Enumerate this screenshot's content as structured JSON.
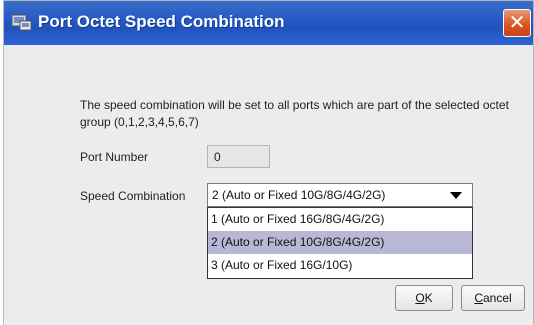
{
  "window": {
    "title": "Port Octet Speed Combination",
    "close_glyph": "✕"
  },
  "description": "The speed combination will be set to all ports which are part of the selected octet group (0,1,2,3,4,5,6,7)",
  "port_number": {
    "label": "Port Number",
    "value": "0"
  },
  "speed_combination": {
    "label": "Speed Combination",
    "selected": "2 (Auto or Fixed 10G/8G/4G/2G)",
    "options": [
      "1 (Auto or Fixed 16G/8G/4G/2G)",
      "2 (Auto or Fixed 10G/8G/4G/2G)",
      "3 (Auto or Fixed 16G/10G)"
    ]
  },
  "buttons": {
    "ok_mnemonic": "O",
    "ok_rest": "K",
    "cancel_mnemonic": "C",
    "cancel_rest": "ancel"
  },
  "colors": {
    "titlebar": "#2458c6",
    "close": "#d9571f",
    "selected_option": "#b8b8d6"
  }
}
